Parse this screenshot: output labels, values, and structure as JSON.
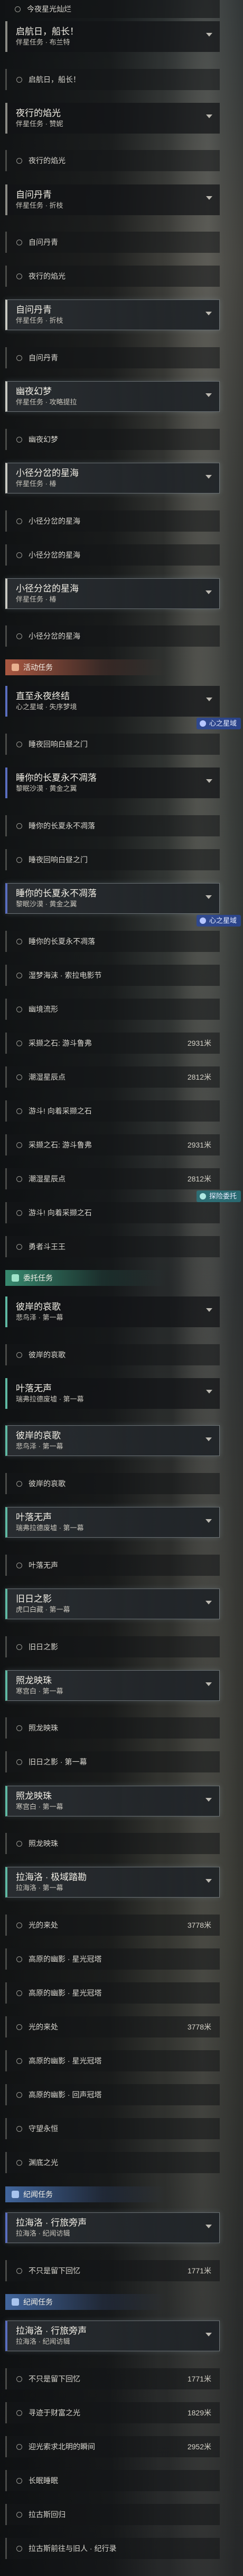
{
  "top_item": "今夜星光灿烂",
  "headers": {
    "activity": "活动任务",
    "daily": "委托任务",
    "memorial": "纪闻任务"
  },
  "tags": {
    "heart": "心之星域",
    "explore": "探险委托"
  },
  "entries": [
    {
      "type": "quest",
      "title": "启航日，船长！",
      "subtitle": "伴星任务 · 布兰特",
      "accent": "gray"
    },
    {
      "type": "sub",
      "text": "启航日，船长！"
    },
    {
      "type": "quest",
      "title": "夜行的焰光",
      "subtitle": "伴星任务 · 赞妮",
      "accent": "gray"
    },
    {
      "type": "sub",
      "text": "夜行的焰光"
    },
    {
      "type": "quest",
      "title": "自问丹青",
      "subtitle": "伴星任务 · 折枝",
      "accent": "gray"
    },
    {
      "type": "sub",
      "text": "自问丹青"
    },
    {
      "type": "sub",
      "text": "夜行的焰光"
    },
    {
      "type": "quest",
      "title": "自问丹青",
      "subtitle": "伴星任务 · 折枝",
      "accent": "gray",
      "selected": true
    },
    {
      "type": "sub",
      "text": "自问丹青"
    },
    {
      "type": "quest",
      "title": "幽夜幻梦",
      "subtitle": "伴星任务 · 攻略提拉",
      "accent": "gray",
      "selected": true
    },
    {
      "type": "sub",
      "text": "幽夜幻梦"
    },
    {
      "type": "quest",
      "title": "小径分岔的星海",
      "subtitle": "伴星任务 · 椿",
      "accent": "gray",
      "selected": true
    },
    {
      "type": "sub",
      "text": "小径分岔的星海"
    },
    {
      "type": "sub",
      "text": "小径分岔的星海"
    },
    {
      "type": "quest",
      "title": "小径分岔的星海",
      "subtitle": "伴星任务 · 椿",
      "accent": "gray",
      "selected": true
    },
    {
      "type": "sub",
      "text": "小径分岔的星海"
    },
    {
      "type": "header",
      "kind": "activity"
    },
    {
      "type": "quest",
      "title": "直至永夜终结",
      "subtitle": "心之星域 · 失序梦境",
      "accent": "blue",
      "tag": "heart"
    },
    {
      "type": "sub",
      "text": "睡夜回响白昼之门"
    },
    {
      "type": "quest",
      "title": "睡你的长夏永不凋落",
      "subtitle": "黎眠沙漠 · 黄金之翼",
      "accent": "blue"
    },
    {
      "type": "sub",
      "text": "睡你的长夏永不凋落"
    },
    {
      "type": "sub",
      "text": "睡夜回响白昼之门"
    },
    {
      "type": "quest",
      "title": "睡你的长夏永不凋落",
      "subtitle": "黎眠沙漠 · 黄金之翼",
      "accent": "blue",
      "selected": true,
      "tag": "heart"
    },
    {
      "type": "sub",
      "text": "睡你的长夏永不凋落"
    },
    {
      "type": "sub",
      "text": "湿梦海沫 · 索拉电影节"
    },
    {
      "type": "sub",
      "text": "幽境流形"
    },
    {
      "type": "sub",
      "text": "采撷之石: 游斗鲁弗",
      "dist": "2931米"
    },
    {
      "type": "sub",
      "text": "潮湿星辰点",
      "dist": "2812米"
    },
    {
      "type": "sub",
      "text": "游斗! 向着采撷之石"
    },
    {
      "type": "sub",
      "text": "采撷之石: 游斗鲁弗",
      "dist": "2931米"
    },
    {
      "type": "sub",
      "text": "潮湿星辰点",
      "dist": "2812米",
      "tag": "explore"
    },
    {
      "type": "sub",
      "text": "游斗! 向着采撷之石"
    },
    {
      "type": "sub",
      "text": "勇者斗王王"
    },
    {
      "type": "header",
      "kind": "daily"
    },
    {
      "type": "quest",
      "title": "彼岸的哀歌",
      "subtitle": "悲鸟泽 · 第一幕",
      "accent": "teal"
    },
    {
      "type": "sub",
      "text": "彼岸的哀歌"
    },
    {
      "type": "quest",
      "title": "叶落无声",
      "subtitle": "瑞弗拉德废墟 · 第一幕",
      "accent": "teal"
    },
    {
      "type": "quest",
      "title": "彼岸的哀歌",
      "subtitle": "悲鸟泽 · 第一幕",
      "accent": "teal",
      "selected": true
    },
    {
      "type": "sub",
      "text": "彼岸的哀歌"
    },
    {
      "type": "quest",
      "title": "叶落无声",
      "subtitle": "瑞弗拉德废墟 · 第一幕",
      "accent": "teal",
      "selected": true
    },
    {
      "type": "sub",
      "text": "叶落无声"
    },
    {
      "type": "quest",
      "title": "旧日之影",
      "subtitle": "虎口白藏 · 第一幕",
      "accent": "teal",
      "selected": true
    },
    {
      "type": "sub",
      "text": "旧日之影"
    },
    {
      "type": "quest",
      "title": "照龙映珠",
      "subtitle": "寒宫白 · 第一幕",
      "accent": "teal",
      "selected": true
    },
    {
      "type": "sub",
      "text": "照龙映珠"
    },
    {
      "type": "sub",
      "text": "旧日之影 · 第一幕"
    },
    {
      "type": "quest",
      "title": "照龙映珠",
      "subtitle": "寒宫白 · 第一幕",
      "accent": "teal",
      "selected": true
    },
    {
      "type": "sub",
      "text": "照龙映珠"
    },
    {
      "type": "quest",
      "title": "拉海洛 · 极域踏勘",
      "subtitle": "拉海洛 · 第一幕",
      "accent": "teal",
      "selected": true
    },
    {
      "type": "sub",
      "text": "光的来处",
      "dist": "3778米"
    },
    {
      "type": "sub",
      "text": "高原的幽影 · 星光冠塔"
    },
    {
      "type": "sub",
      "text": "高原的幽影 · 星光冠塔"
    },
    {
      "type": "sub",
      "text": "光的来处",
      "dist": "3778米"
    },
    {
      "type": "sub",
      "text": "高原的幽影 · 星光冠塔"
    },
    {
      "type": "sub",
      "text": "高原的幽影 · 回声冠塔"
    },
    {
      "type": "sub",
      "text": "守望永恒"
    },
    {
      "type": "sub",
      "text": "渊底之光"
    },
    {
      "type": "header",
      "kind": "memorial"
    },
    {
      "type": "quest",
      "title": "拉海洛 · 行旅旁声",
      "subtitle": "拉海洛 · 纪闻访辑",
      "accent": "blue",
      "selected": true
    },
    {
      "type": "sub",
      "text": "不只是留下回忆",
      "dist": "1771米"
    },
    {
      "type": "header",
      "kind": "memorial"
    },
    {
      "type": "quest",
      "title": "拉海洛 · 行旅旁声",
      "subtitle": "拉海洛 · 纪闻访辑",
      "accent": "blue",
      "selected": true
    },
    {
      "type": "sub",
      "text": "不只是留下回忆",
      "dist": "1771米"
    },
    {
      "type": "sub",
      "text": "寻迹于财富之光",
      "dist": "1829米"
    },
    {
      "type": "sub",
      "text": "迎光索求北明的瞬间",
      "dist": "2952米"
    },
    {
      "type": "sub",
      "text": "长眠睡眠"
    },
    {
      "type": "sub",
      "text": "拉古斯回归"
    },
    {
      "type": "sub",
      "text": "拉古斯前往与旧人 · 纪行录"
    }
  ]
}
